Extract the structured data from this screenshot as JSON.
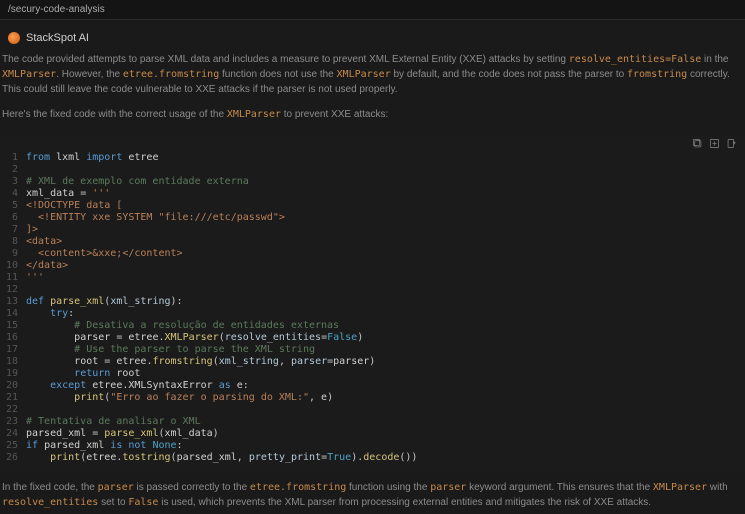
{
  "topbar": {
    "path": "/secury-code-analysis"
  },
  "header": {
    "title": "StackSpot AI"
  },
  "msg": {
    "p1a": "The code provided attempts to parse XML data and includes a measure to prevent XML External Entity (XXE) attacks by setting ",
    "p1b": "resolve_entities=False",
    "p1c": " in the ",
    "p1d": "XMLParser",
    "p1e": ". However, the ",
    "p2a": "etree.fromstring",
    "p2b": " function does not use the ",
    "p2c": "XMLParser",
    "p2d": " by default, and the code does not pass the parser to ",
    "p2e": "fromstring",
    "p2f": " correctly. This could still leave the code vulnerable to XXE attacks if the parser is not used properly.",
    "p3a": "Here's the fixed code with the correct usage of the ",
    "p3b": "XMLParser",
    "p3c": " to prevent XXE attacks:"
  },
  "code": {
    "lines": [
      [
        [
          "key",
          "from "
        ],
        [
          "mod",
          "lxml "
        ],
        [
          "key",
          "import "
        ],
        [
          "mod",
          "etree"
        ]
      ],
      [],
      [
        [
          "com",
          "# XML de exemplo com entidade externa"
        ]
      ],
      [
        [
          "mod",
          "xml_data "
        ],
        [
          "op",
          "= "
        ],
        [
          "str",
          "'''"
        ]
      ],
      [
        [
          "str",
          "<!DOCTYPE data ["
        ]
      ],
      [
        [
          "str",
          "  <!ENTITY xxe SYSTEM \"file:///etc/passwd\">"
        ]
      ],
      [
        [
          "str",
          "]>"
        ]
      ],
      [
        [
          "str",
          "<data>"
        ]
      ],
      [
        [
          "str",
          "  <content>&xxe;</content>"
        ]
      ],
      [
        [
          "str",
          "</data>"
        ]
      ],
      [
        [
          "str",
          "'''"
        ]
      ],
      [],
      [
        [
          "key",
          "def "
        ],
        [
          "fn",
          "parse_xml"
        ],
        [
          "op",
          "("
        ],
        [
          "var",
          "xml_string"
        ],
        [
          "op",
          "):"
        ]
      ],
      [
        [
          "op",
          "    "
        ],
        [
          "key",
          "try"
        ],
        [
          "op",
          ":"
        ]
      ],
      [
        [
          "op",
          "        "
        ],
        [
          "com",
          "# Desativa a resolução de entidades externas"
        ]
      ],
      [
        [
          "op",
          "        "
        ],
        [
          "mod",
          "parser "
        ],
        [
          "op",
          "= "
        ],
        [
          "mod",
          "etree"
        ],
        [
          "op",
          "."
        ],
        [
          "fn",
          "XMLParser"
        ],
        [
          "op",
          "("
        ],
        [
          "var",
          "resolve_entities"
        ],
        [
          "op",
          "="
        ],
        [
          "lit",
          "False"
        ],
        [
          "op",
          ")"
        ]
      ],
      [
        [
          "op",
          "        "
        ],
        [
          "com",
          "# Use the parser to parse the XML string"
        ]
      ],
      [
        [
          "op",
          "        "
        ],
        [
          "mod",
          "root "
        ],
        [
          "op",
          "= "
        ],
        [
          "mod",
          "etree"
        ],
        [
          "op",
          "."
        ],
        [
          "fn",
          "fromstring"
        ],
        [
          "op",
          "("
        ],
        [
          "var",
          "xml_string"
        ],
        [
          "op",
          ", "
        ],
        [
          "var",
          "parser"
        ],
        [
          "op",
          "="
        ],
        [
          "mod",
          "parser"
        ],
        [
          "op",
          ")"
        ]
      ],
      [
        [
          "op",
          "        "
        ],
        [
          "key",
          "return "
        ],
        [
          "mod",
          "root"
        ]
      ],
      [
        [
          "op",
          "    "
        ],
        [
          "key",
          "except "
        ],
        [
          "mod",
          "etree"
        ],
        [
          "op",
          "."
        ],
        [
          "mod",
          "XMLSyntaxError "
        ],
        [
          "key",
          "as "
        ],
        [
          "mod",
          "e"
        ],
        [
          "op",
          ":"
        ]
      ],
      [
        [
          "op",
          "        "
        ],
        [
          "fn",
          "print"
        ],
        [
          "op",
          "("
        ],
        [
          "str",
          "\"Erro ao fazer o parsing do XML:\""
        ],
        [
          "op",
          ", "
        ],
        [
          "mod",
          "e"
        ],
        [
          "op",
          ")"
        ]
      ],
      [],
      [
        [
          "com",
          "# Tentativa de analisar o XML"
        ]
      ],
      [
        [
          "mod",
          "parsed_xml "
        ],
        [
          "op",
          "= "
        ],
        [
          "fn",
          "parse_xml"
        ],
        [
          "op",
          "("
        ],
        [
          "mod",
          "xml_data"
        ],
        [
          "op",
          ")"
        ]
      ],
      [
        [
          "key",
          "if "
        ],
        [
          "mod",
          "parsed_xml "
        ],
        [
          "key",
          "is not "
        ],
        [
          "lit",
          "None"
        ],
        [
          "op",
          ":"
        ]
      ],
      [
        [
          "op",
          "    "
        ],
        [
          "fn",
          "print"
        ],
        [
          "op",
          "("
        ],
        [
          "mod",
          "etree"
        ],
        [
          "op",
          "."
        ],
        [
          "fn",
          "tostring"
        ],
        [
          "op",
          "("
        ],
        [
          "mod",
          "parsed_xml"
        ],
        [
          "op",
          ", "
        ],
        [
          "var",
          "pretty_print"
        ],
        [
          "op",
          "="
        ],
        [
          "lit",
          "True"
        ],
        [
          "op",
          ")."
        ],
        [
          "fn",
          "decode"
        ],
        [
          "op",
          "())"
        ]
      ]
    ]
  },
  "footer": {
    "a": "In the fixed code, the ",
    "b": "parser",
    "c": " is passed correctly to the ",
    "d": "etree.fromstring",
    "e": " function using the ",
    "f": "parser",
    "g": " keyword argument. This ensures that the ",
    "h": "XMLParser",
    "i": " with ",
    "j": "resolve_entities",
    "k": " set to ",
    "l": "False",
    "m": " is used, which prevents the XML parser from processing external entities and mitigates the risk of XXE attacks."
  }
}
